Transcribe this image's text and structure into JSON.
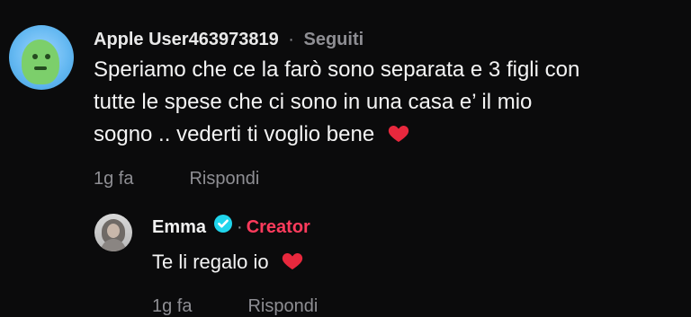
{
  "comment": {
    "username": "Apple User463973819",
    "separator": "·",
    "follow_status": "Seguiti",
    "text_lines": [
      "Speriamo che ce la farò sono separata e 3 figli con",
      "tutte le spese che ci sono in una casa e’ il mio",
      "sogno .. vederti ti voglio bene"
    ],
    "time": "1g fa",
    "reply_label": "Rispondi"
  },
  "reply": {
    "username": "Emma",
    "separator": "·",
    "creator_label": "Creator",
    "text": "Te li regalo io",
    "time": "1g fa",
    "reply_label": "Rispondi"
  },
  "colors": {
    "background": "#0b0b0c",
    "muted": "#8e8e93",
    "accent": "#ff3b5c",
    "verified": "#20d5ec"
  },
  "icons": {
    "heart": "heart-icon",
    "verified": "verified-badge-icon"
  }
}
